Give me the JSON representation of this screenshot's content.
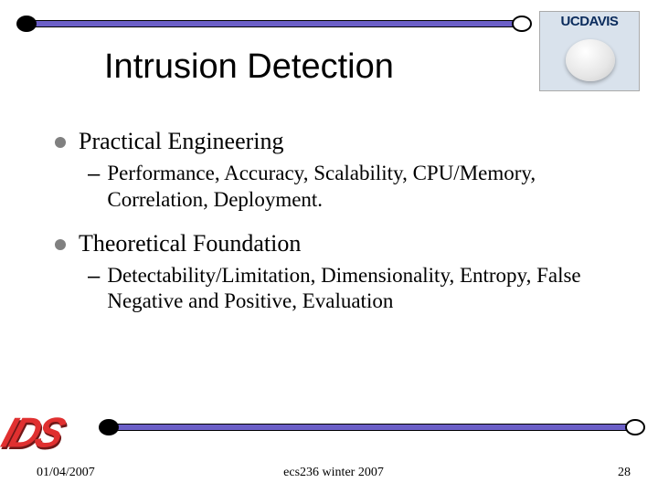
{
  "logo": {
    "line1": "UCDAVIS"
  },
  "slide": {
    "title": "Intrusion Detection",
    "bullets": [
      {
        "label": "Practical Engineering",
        "sub": "Performance, Accuracy, Scalability, CPU/Memory, Correlation, Deployment."
      },
      {
        "label": "Theoretical Foundation",
        "sub": "Detectability/Limitation, Dimensionality, Entropy, False Negative and Positive, Evaluation"
      }
    ]
  },
  "decor": {
    "ids_text": "IDS"
  },
  "footer": {
    "date": "01/04/2007",
    "course": "ecs236 winter 2007",
    "page": "28"
  }
}
